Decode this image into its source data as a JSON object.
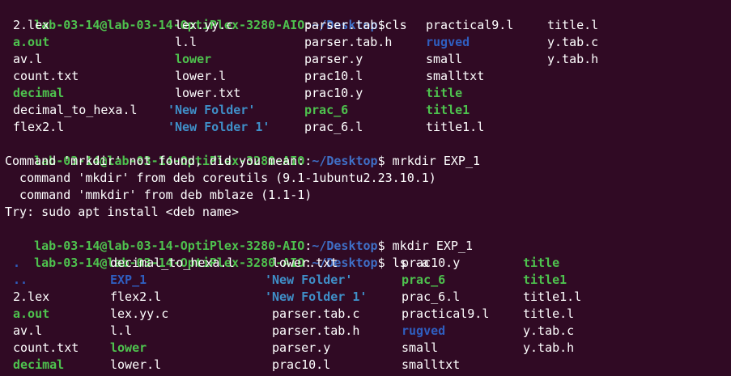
{
  "prompt": {
    "user": "lab-03-14@lab-03-14-OptiPlex-3280-AIO",
    "colon": ":",
    "path": "~/Desktop",
    "symbol": "$"
  },
  "commands": {
    "c1": "ls",
    "c2": "mrkdir EXP_1",
    "c3": "mkdir EXP_1",
    "c4": "ls -a"
  },
  "ls1": [
    [
      "2.lex",
      "lex.yy.c",
      "parser.tab.c",
      "practical9.l",
      "title.l"
    ],
    [
      "a.out",
      "l.l",
      "parser.tab.h",
      "rugved",
      "y.tab.c"
    ],
    [
      "av.l",
      "lower",
      "parser.y",
      "small",
      "y.tab.h"
    ],
    [
      "count.txt",
      "lower.l",
      "prac10.l",
      "smalltxt",
      ""
    ],
    [
      "decimal",
      "lower.txt",
      "prac10.y",
      "title",
      ""
    ],
    [
      "decimal_to_hexa.l",
      "'New Folder'",
      "prac_6",
      "title1",
      ""
    ],
    [
      "flex2.l",
      "'New Folder 1'",
      "prac_6.l",
      "title1.l",
      ""
    ]
  ],
  "error": {
    "line1": "Command 'mrkdir' not found, did you mean:",
    "line2": "  command 'mkdir' from deb coreutils (9.1-1ubuntu2.23.10.1)",
    "line3": "  command 'mmkdir' from deb mblaze (1.1-1)",
    "line4": "Try: sudo apt install <deb name>"
  },
  "ls2": [
    [
      ".",
      "decimal_to_hexa.l",
      "lower.txt",
      "prac10.y",
      "title"
    ],
    [
      "..",
      "EXP_1",
      "'New Folder'",
      "prac_6",
      "title1"
    ],
    [
      "2.lex",
      "flex2.l",
      "'New Folder 1'",
      "prac_6.l",
      "title1.l"
    ],
    [
      "a.out",
      "lex.yy.c",
      "parser.tab.c",
      "practical9.l",
      "title.l"
    ],
    [
      "av.l",
      "l.l",
      "parser.tab.h",
      "rugved",
      "y.tab.c"
    ],
    [
      "count.txt",
      "lower",
      "parser.y",
      "small",
      "y.tab.h"
    ],
    [
      "decimal",
      "lower.l",
      "prac10.l",
      "smalltxt",
      ""
    ]
  ],
  "colors": {
    "background": "#300a24",
    "prompt_user": "#4ec24e",
    "prompt_path": "#3f6fc6",
    "directory": "#2f5ec0",
    "executable": "#4ec24e",
    "text": "#ffffff"
  }
}
